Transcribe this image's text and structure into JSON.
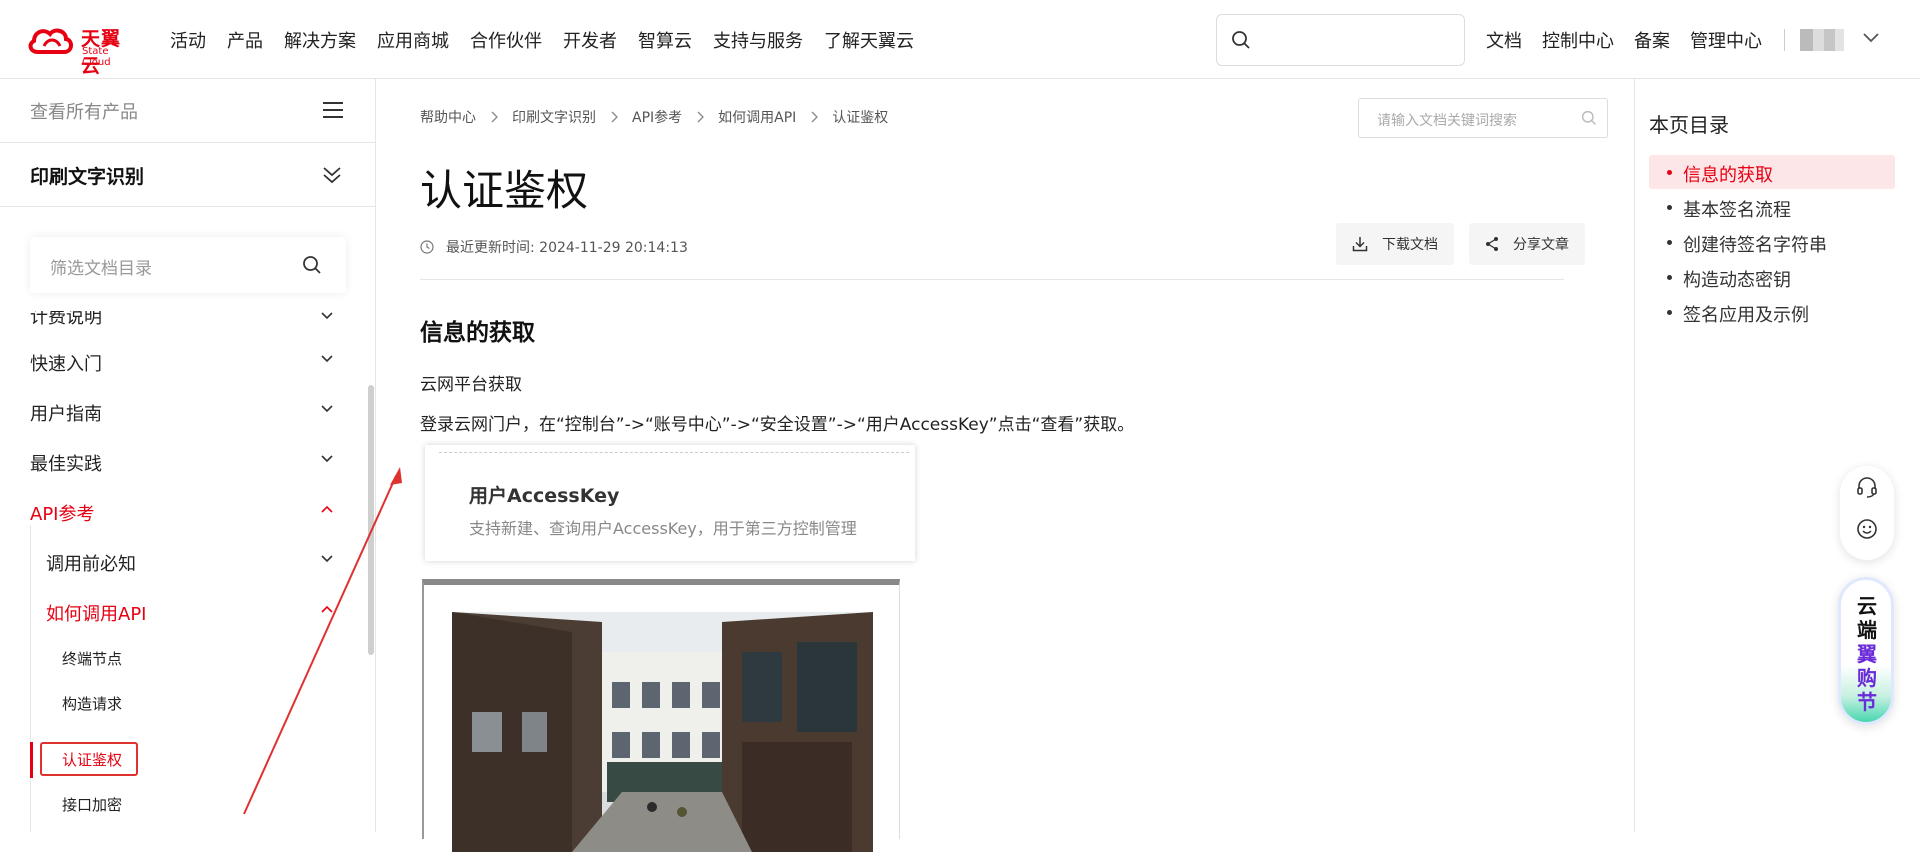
{
  "header": {
    "logo_cn": "天翼云",
    "logo_en": "State Cloud",
    "nav": [
      "活动",
      "产品",
      "解决方案",
      "应用商城",
      "合作伙伴",
      "开发者",
      "智算云",
      "支持与服务",
      "了解天翼云"
    ],
    "right_nav": [
      "文档",
      "控制中心",
      "备案",
      "管理中心"
    ]
  },
  "sidebar": {
    "all_products": "查看所有产品",
    "product": "印刷文字识别",
    "filter_placeholder": "筛选文档目录",
    "items": [
      {
        "label": "计费说明"
      },
      {
        "label": "快速入门"
      },
      {
        "label": "用户指南"
      },
      {
        "label": "最佳实践"
      },
      {
        "label": "API参考"
      },
      {
        "label": "调用前必知"
      },
      {
        "label": "如何调用API"
      },
      {
        "label": "终端节点"
      },
      {
        "label": "构造请求"
      },
      {
        "label": "认证鉴权"
      },
      {
        "label": "接口加密"
      }
    ]
  },
  "breadcrumb": [
    "帮助中心",
    "印刷文字识别",
    "API参考",
    "如何调用API",
    "认证鉴权"
  ],
  "doc_search_placeholder": "请输入文档关键词搜索",
  "page": {
    "title": "认证鉴权",
    "updated": "最近更新时间: 2024-11-29 20:14:13",
    "download_label": "下载文档",
    "share_label": "分享文章",
    "section_title": "信息的获取",
    "para1": "云网平台获取",
    "para2": "登录云网门户，在“控制台”->“账号中心”->“安全设置”->“用户AccessKey”点击“查看”获取。",
    "card_title": "用户AccessKey",
    "card_desc": "支持新建、查询用户AccessKey，用于第三方控制管理"
  },
  "toc": {
    "title": "本页目录",
    "items": [
      "信息的获取",
      "基本签名流程",
      "创建待签名字符串",
      "构造动态密钥",
      "签名应用及示例"
    ]
  },
  "promo": {
    "line1": "云端",
    "line2": "翼购节"
  },
  "colors": {
    "brand_red": "#e60012",
    "annotation_red": "#e03131",
    "toc_active_bg": "#fde6e8"
  }
}
